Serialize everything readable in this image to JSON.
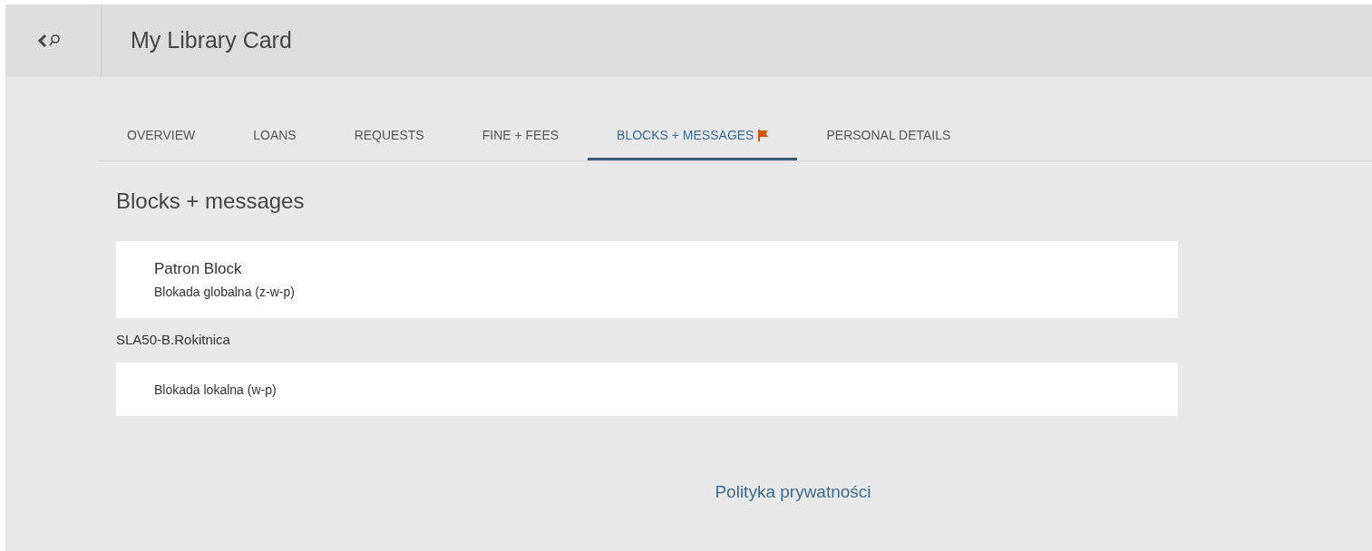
{
  "header": {
    "title": "My Library Card"
  },
  "tabs": [
    {
      "label": "OVERVIEW",
      "selected": false,
      "flagged": false
    },
    {
      "label": "LOANS",
      "selected": false,
      "flagged": false
    },
    {
      "label": "REQUESTS",
      "selected": false,
      "flagged": false
    },
    {
      "label": "FINE + FEES",
      "selected": false,
      "flagged": false
    },
    {
      "label": "BLOCKS + MESSAGES",
      "selected": true,
      "flagged": true
    },
    {
      "label": "PERSONAL DETAILS",
      "selected": false,
      "flagged": false
    }
  ],
  "section_title": "Blocks + messages",
  "blocks": [
    {
      "title": "Patron Block",
      "description": "Blokada globalna (z-w-p)"
    },
    {
      "group": "SLA50-B.Rokitnica",
      "description": "Blokada lokalna (w-p)"
    }
  ],
  "footer_link": "Polityka prywatności"
}
